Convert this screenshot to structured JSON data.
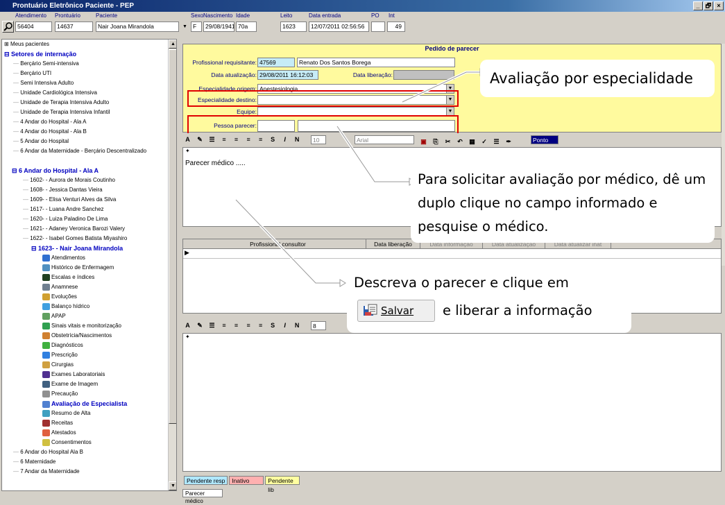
{
  "window": {
    "title": "Prontuário Eletrônico Paciente - PEP",
    "btn_min": "_",
    "btn_restore": "🗗",
    "btn_close": "×"
  },
  "header": {
    "labels": {
      "atendimento": "Atendimento",
      "prontuario": "Prontuário",
      "paciente": "Paciente",
      "sexo": "Sexo",
      "nascimento": "Nascimento",
      "idade": "Idade",
      "leito": "Leito",
      "data_entrada": "Data entrada",
      "po": "PO",
      "int": "Int"
    },
    "values": {
      "atendimento": "56404",
      "prontuario": "14637",
      "paciente": "Nair Joana Mirandola",
      "sexo": "F",
      "nascimento": "29/08/1941",
      "idade": "70a",
      "leito": "1623",
      "data_entrada": "12/07/2011 02:56:56",
      "po": "",
      "int": "49"
    }
  },
  "tree": {
    "meus_pacientes": "Meus pacientes",
    "setores": "Setores de internação",
    "units": [
      "Berçário Semi-intensiva",
      "Berçário UTI",
      "Semi Intensiva Adulto",
      "Unidade Cardiológica Intensiva",
      "Unidade de Terapia Intensiva Adulto",
      "Unidade de Terapia Intensiva Infantil",
      "4 Andar do Hospital - Ala A",
      "4 Andar do Hospital - Ala B",
      "5 Andar do Hospital",
      "6 Andar da Maternidade - Berçário Descentralizado"
    ],
    "ala": "6 Andar do Hospital - Ala A",
    "beds": [
      "1602-  - Aurora de Morais Coutinho",
      "1608-  - Jessica Dantas Vieira",
      "1609-  - Elisa Venturi Alves da Silva",
      "1617-  - Luana Andre Sanchez",
      "1620-  - Luiza Paladino De Lima",
      "1621-  - Adaney Veronica Barozi Valery",
      "1622-  - Isabel Gomes Batista Miyashiro"
    ],
    "patient": "1623-  - Nair Joana Mirandola",
    "menu": [
      "Atendimentos",
      "Histórico de Enfermagem",
      "Escalas e índices",
      "Anamnese",
      "Evoluções",
      "Balanço hídrico",
      "APAP",
      "Sinais vitais e monitorização",
      "Obstetrícia/Nascimentos",
      "Diagnósticos",
      "Prescrição",
      "Cirurgias",
      "Exames Laboratoriais",
      "Exame de Imagem",
      "Precaução",
      "Avaliação de Especialista",
      "Resumo de Alta",
      "Receitas",
      "Atestados",
      "Consentimentos"
    ],
    "tail": [
      "6 Andar do Hospital Ala B",
      "6 Maternidade",
      "7 Andar da Maternidade"
    ]
  },
  "form": {
    "title": "Pedido de parecer",
    "profissional_label": "Profissional requisitante:",
    "profissional_code": "47569",
    "profissional_name": "Renato Dos Santos Borega",
    "data_atualizacao_label": "Data atualização:",
    "data_atualizacao": "29/08/2011 16:12:03",
    "data_liberacao_label": "Data liberação:",
    "data_liberacao": "",
    "esp_origem_label": "Especialidade origem:",
    "esp_origem": "Anestesiologia",
    "esp_destino_label": "Especialidade destino:",
    "esp_destino": "",
    "equipe_label": "Equipe:",
    "equipe": "",
    "pessoa_label": "Pessoa parecer:",
    "pessoa_code": "",
    "pessoa_name": ""
  },
  "editor": {
    "text": "Parecer médico .....",
    "font_size": "10",
    "font_name": "Arial",
    "font_size2": "8",
    "ponto": "Ponto"
  },
  "grid": {
    "columns": [
      "Profissional consultor",
      "Data liberação",
      "Data informação",
      "Data atualização",
      "Data atualizar inat"
    ]
  },
  "status": {
    "pendente_resp": "Pendente resp",
    "inativo": "Inativo",
    "pendente_lib": "Pendente lib"
  },
  "bottom_tab": "Parecer médico",
  "annotations": {
    "c1": "Avaliação por especialidade",
    "c2": "Para solicitar avaliação por médico, dê um duplo clique no campo informado e pesquise o médico.",
    "c3": "Descreva o parecer e clique em",
    "salvar": "Salvar",
    "c4": "e liberar a informação"
  },
  "colors": {
    "form_bg": "#fffa9e",
    "highlight": "#e00000",
    "tree_blue": "#0000c0",
    "title_blue": "#0a246a",
    "pink": "#ffb0b0",
    "cyan": "#b0e8ff",
    "yellow": "#ffffa0"
  }
}
